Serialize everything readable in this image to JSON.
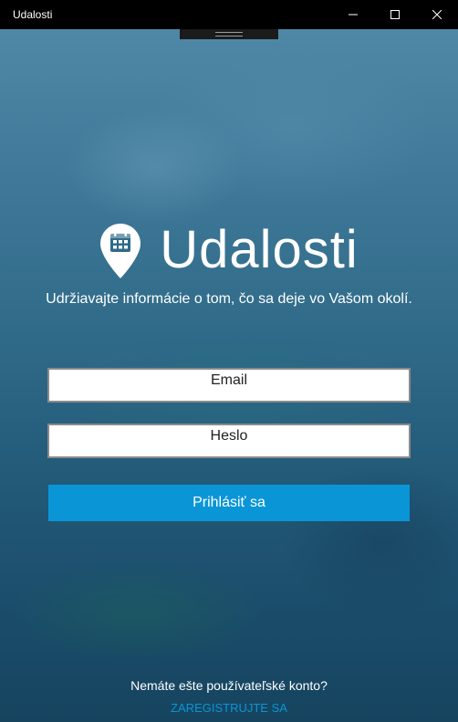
{
  "window": {
    "title": "Udalosti",
    "controls": {
      "minimize_icon": "minimize-icon",
      "maximize_icon": "maximize-icon",
      "close_icon": "close-icon"
    }
  },
  "app": {
    "name": "Udalosti",
    "logo_icon": "map-pin-calendar-icon",
    "tagline": "Udržiavajte informácie o tom, čo sa deje vo Vašom okolí."
  },
  "form": {
    "email": {
      "placeholder": "Email",
      "value": ""
    },
    "password": {
      "placeholder": "Heslo",
      "value": ""
    },
    "login_label": "Prihlásiť sa"
  },
  "signup": {
    "prompt": "Nemáte ešte používateľské konto?",
    "link_label": "ZAREGISTRUJTE SA"
  },
  "colors": {
    "accent": "#0a96d6",
    "titlebar": "#000000",
    "text": "#ffffff"
  }
}
